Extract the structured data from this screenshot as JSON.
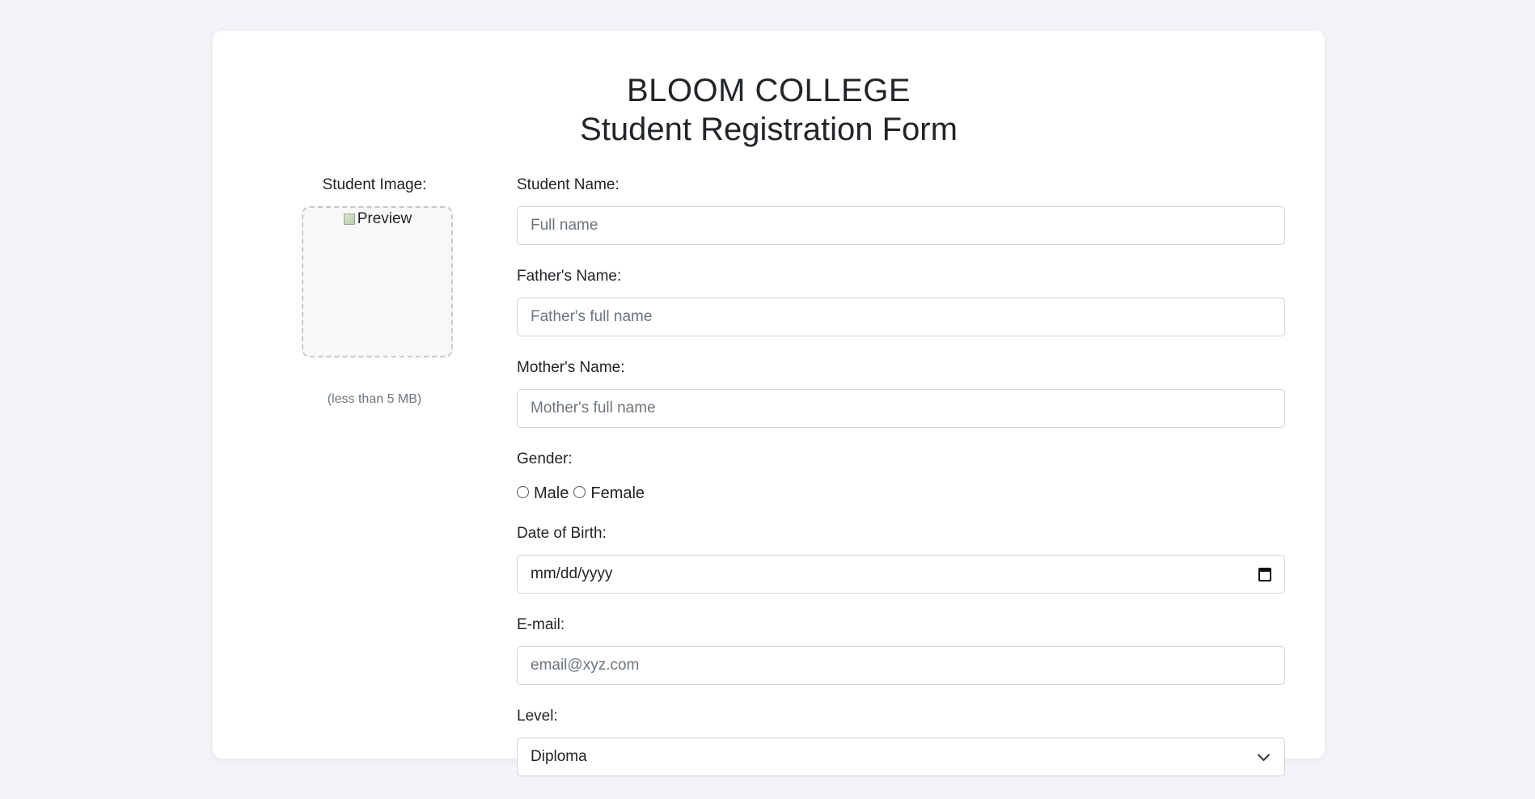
{
  "header": {
    "college_name": "BLOOM COLLEGE",
    "form_title": "Student Registration Form"
  },
  "image_upload": {
    "label": "Student Image:",
    "preview_alt": "Preview",
    "note": "(less than 5 MB)"
  },
  "fields": {
    "student_name": {
      "label": "Student Name:",
      "placeholder": "Full name",
      "value": ""
    },
    "father_name": {
      "label": "Father's Name:",
      "placeholder": "Father's full name",
      "value": ""
    },
    "mother_name": {
      "label": "Mother's Name:",
      "placeholder": "Mother's full name",
      "value": ""
    },
    "gender": {
      "label": "Gender:",
      "options": [
        "Male",
        "Female"
      ],
      "selected": null
    },
    "dob": {
      "label": "Date of Birth:",
      "placeholder": "mm/dd/yyyy"
    },
    "email": {
      "label": "E-mail:",
      "placeholder": "email@xyz.com",
      "value": ""
    },
    "level": {
      "label": "Level:",
      "selected": "Diploma"
    }
  },
  "icons": {
    "calendar": "calendar-icon",
    "dropdown": "chevron-down-icon",
    "broken_image": "broken-image-icon"
  }
}
